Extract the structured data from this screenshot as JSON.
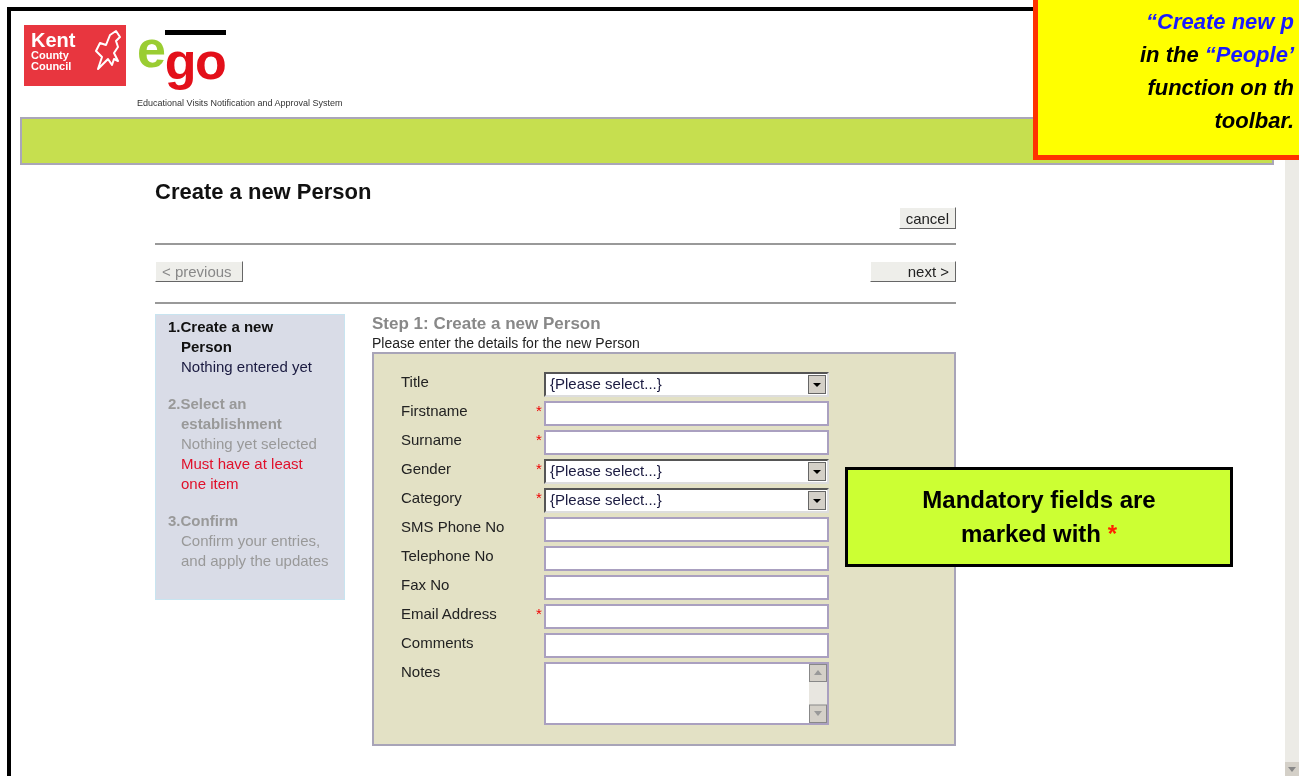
{
  "header": {
    "council_logo": [
      "Kent",
      "County",
      "Council"
    ],
    "app_logo": {
      "first": "e",
      "rest": "go"
    },
    "app_subtitle": "Educational Visits Notification and Approval System"
  },
  "page_title": "Create a new Person",
  "buttons": {
    "cancel": "cancel",
    "previous": {
      "label": "< previous",
      "disabled": true
    },
    "next": {
      "label": "next >",
      "disabled": false
    }
  },
  "steps": [
    {
      "number": "1.",
      "title": "Create a new Person",
      "description": "Nothing entered yet",
      "selected": true
    },
    {
      "number": "2.",
      "title": "Select an establishment",
      "description": "Nothing yet selected",
      "error": "Must have at least one item",
      "selected": false
    },
    {
      "number": "3.",
      "title": "Confirm",
      "description": "Confirm your entries, and apply the updates",
      "selected": false
    }
  ],
  "form": {
    "heading": "Step 1: Create a new Person",
    "intro": "Please enter the details for the new Person",
    "fields": [
      {
        "label": "Title",
        "kind": "select",
        "required": false,
        "value": "{Please select...}"
      },
      {
        "label": "Firstname",
        "kind": "text",
        "required": true
      },
      {
        "label": "Surname",
        "kind": "text",
        "required": true
      },
      {
        "label": "Gender",
        "kind": "select",
        "required": true,
        "value": "{Please select...}"
      },
      {
        "label": "Category",
        "kind": "select",
        "required": true,
        "value": "{Please select...}"
      },
      {
        "label": "SMS Phone No",
        "kind": "text",
        "required": false
      },
      {
        "label": "Telephone No",
        "kind": "text",
        "required": false
      },
      {
        "label": "Fax No",
        "kind": "text",
        "required": false
      },
      {
        "label": "Email Address",
        "kind": "text",
        "required": true
      },
      {
        "label": "Comments",
        "kind": "text",
        "required": false
      },
      {
        "label": "Notes",
        "kind": "textarea",
        "required": false
      }
    ]
  },
  "callouts": [
    {
      "kind": "top",
      "lines": [
        [
          {
            "text": "“Create new p",
            "emphasis": true
          }
        ],
        [
          {
            "text": "in the ",
            "emphasis": false
          },
          {
            "text": "“People’",
            "emphasis": true
          }
        ],
        [
          {
            "text": "function on th",
            "emphasis": false
          }
        ],
        [
          {
            "text": "toolbar.",
            "emphasis": false
          }
        ]
      ]
    },
    {
      "kind": "note",
      "lines": [
        [
          {
            "text": "Mandatory fields are",
            "emphasis": false
          }
        ],
        [
          {
            "text": "marked with ",
            "emphasis": false
          },
          {
            "text": "*",
            "emphasis": true
          }
        ]
      ]
    }
  ]
}
